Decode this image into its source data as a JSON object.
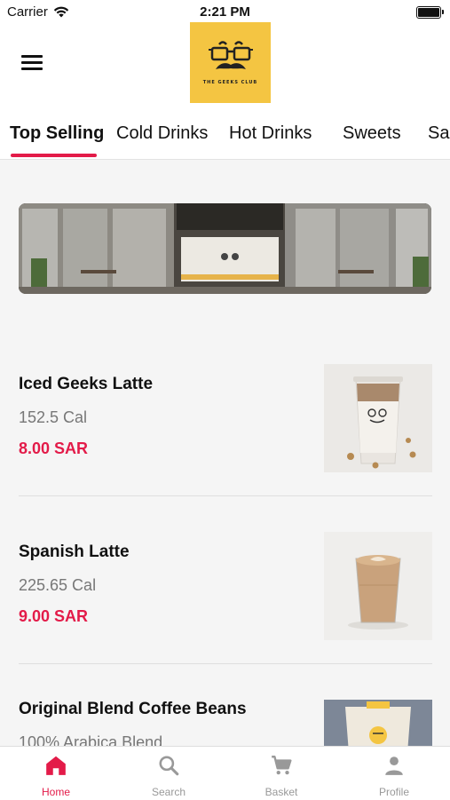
{
  "status_bar": {
    "carrier": "Carrier",
    "time": "2:21 PM"
  },
  "header": {
    "logo_text": "THE GEEKS CLUB"
  },
  "tabs": [
    {
      "label": "Top Selling",
      "active": true
    },
    {
      "label": "Cold Drinks"
    },
    {
      "label": "Hot Drinks"
    },
    {
      "label": "Sweets"
    },
    {
      "label": "Sa"
    }
  ],
  "products": [
    {
      "name": "Iced Geeks Latte",
      "calories": "152.5 Cal",
      "price": "8.00 SAR",
      "image": "iced-latte-cup"
    },
    {
      "name": "Spanish Latte",
      "calories": "225.65 Cal",
      "price": "9.00 SAR",
      "image": "spanish-latte-glass"
    },
    {
      "name": "Original Blend Coffee Beans",
      "calories": "100% Arabica Blend",
      "price": "",
      "image": "coffee-beans-bag"
    }
  ],
  "bottom_nav": [
    {
      "label": "Home",
      "icon": "home-icon",
      "active": true
    },
    {
      "label": "Search",
      "icon": "search-icon"
    },
    {
      "label": "Basket",
      "icon": "basket-icon"
    },
    {
      "label": "Profile",
      "icon": "profile-icon"
    }
  ],
  "colors": {
    "accent": "#e31b49",
    "logo_bg": "#f4c542"
  }
}
